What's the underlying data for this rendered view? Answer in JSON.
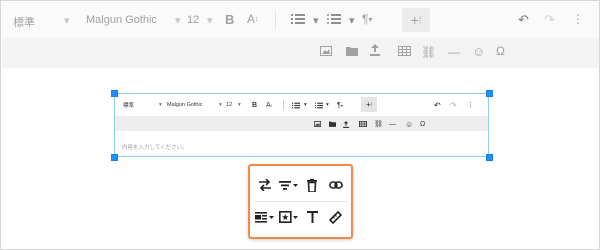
{
  "background_editor": {
    "paragraph_style": "標準",
    "font_family": "Malgun Gothic",
    "font_size": "12",
    "placeholder": "内容を入力してください。"
  },
  "embedded_editor": {
    "paragraph_style": "標準",
    "font_family": "Malgun Gothic",
    "font_size": "12",
    "placeholder": "内容を入力してください。"
  },
  "context_menu": {
    "row1": [
      "swap-icon",
      "align-dropdown-icon",
      "delete-icon",
      "link-icon"
    ],
    "row2": [
      "layout-dropdown-icon",
      "image-style-dropdown-icon",
      "text-icon",
      "measure-icon"
    ],
    "accent_color": "#f08a4b"
  },
  "colors": {
    "selection_border": "#8ecdf0",
    "selection_handle": "#1e90ff"
  }
}
